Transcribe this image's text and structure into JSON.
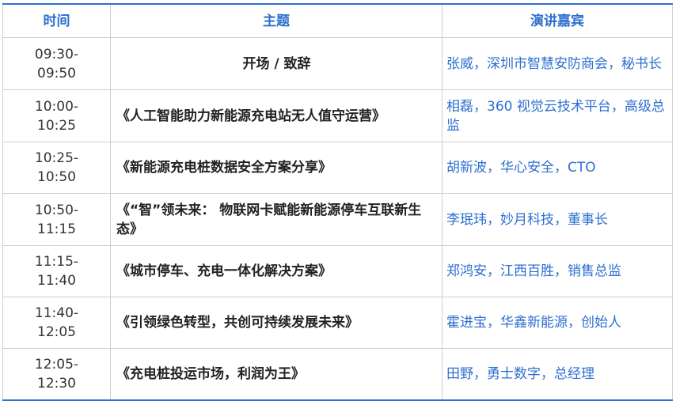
{
  "table": {
    "headers": {
      "time": "时间",
      "topic": "主题",
      "speaker": "演讲嘉宾"
    },
    "rows": [
      {
        "time_start": "09:30-",
        "time_end": "09:50",
        "topic": "开场 / 致辞",
        "speaker": "张威，深圳市智慧安防商会，秘书长"
      },
      {
        "time_start": "10:00-",
        "time_end": "10:25",
        "topic": "《人工智能助力新能源充电站无人值守运营》",
        "speaker": "相磊，360 视觉云技术平台，高级总监"
      },
      {
        "time_start": "10:25-",
        "time_end": "10:50",
        "topic": "《新能源充电桩数据安全方案分享》",
        "speaker": "胡新波，华心安全，CTO"
      },
      {
        "time_start": "10:50-",
        "time_end": "11:15",
        "topic": "《“智”领未来： 物联网卡赋能新能源停车互联新生态》",
        "speaker": "李珉玮，妙月科技，董事长"
      },
      {
        "time_start": "11:15-",
        "time_end": "11:40",
        "topic": "《城市停车、充电一体化解决方案》",
        "speaker": "郑鸿安，江西百胜，销售总监"
      },
      {
        "time_start": "11:40-",
        "time_end": "12:05",
        "topic": "《引领绿色转型，共创可持续发展未来》",
        "speaker": "霍进宝，华鑫新能源，创始人"
      },
      {
        "time_start": "12:05-",
        "time_end": "12:30",
        "topic": "《充电桩投运市场，利润为王》",
        "speaker": "田野，勇士数字，总经理"
      }
    ]
  },
  "colors": {
    "accent": "#2e6fd0",
    "border": "#cfcfcf",
    "text": "#222222"
  }
}
